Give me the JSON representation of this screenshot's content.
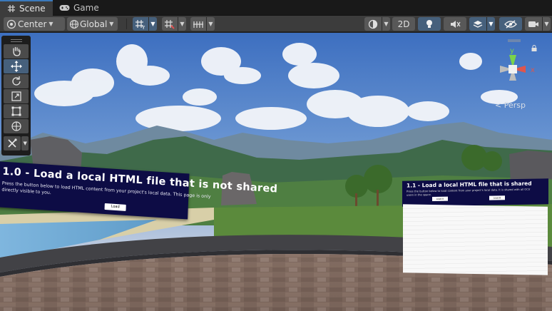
{
  "tabs": [
    {
      "label": "Scene",
      "icon": "hash-grid-icon",
      "active": true
    },
    {
      "label": "Game",
      "icon": "gamepad-icon",
      "active": false
    }
  ],
  "toolbar": {
    "pivot_mode": "Center",
    "pivot_rotation": "Global",
    "mode_2d": "2D",
    "accent": "#46607c"
  },
  "tool_palette": [
    "hand-tool",
    "move-tool",
    "rotate-tool",
    "scale-tool",
    "rect-tool",
    "transform-tool",
    "custom-tool"
  ],
  "gizmo": {
    "y_label": "y",
    "x_label": "x",
    "projection": "< Persp"
  },
  "panels": {
    "left": {
      "title": "1.0 - Load a local HTML file that is not shared",
      "desc_line1": "Press the button below to load HTML content from your project's local data. This page is only",
      "desc_line2": "directly visible to you.",
      "button": "Load"
    },
    "right": {
      "title": "1.1 - Load a local HTML file that is shared",
      "desc_line1": "Press the button below to load content from your project's local data. It is shared with all OCV",
      "desc_line2": "users in the space.",
      "button_a": "Load A",
      "button_b": "Load B"
    }
  }
}
